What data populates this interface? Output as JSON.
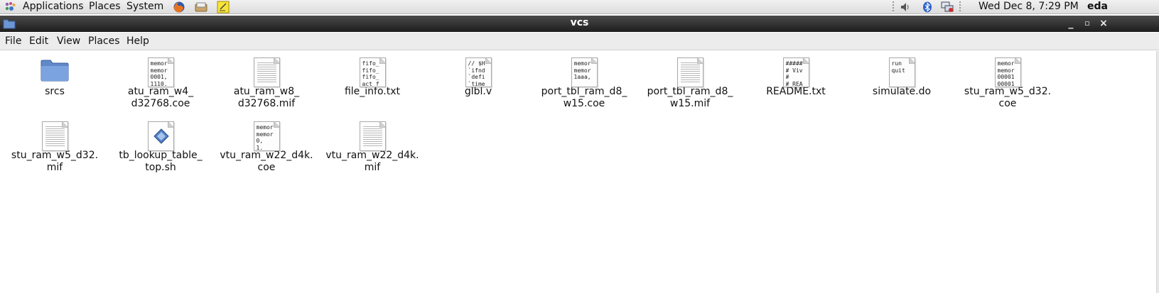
{
  "top_panel": {
    "menus": [
      "Applications",
      "Places",
      "System"
    ],
    "launchers": [
      "firefox-icon",
      "file-manager-icon",
      "notes-icon"
    ],
    "tray": [
      "volume-icon",
      "bluetooth-icon",
      "network-icon"
    ],
    "datetime": "Wed Dec  8,  7:29 PM",
    "user": "eda"
  },
  "window": {
    "title": "vcs",
    "controls": [
      "minimize",
      "maximize",
      "close"
    ]
  },
  "menubar": [
    "File",
    "Edit",
    "View",
    "Places",
    "Help"
  ],
  "files": [
    {
      "name": "srcs",
      "type": "folder"
    },
    {
      "name": "atu_ram_w4_\nd32768.coe",
      "type": "text",
      "preview": "memor\nmemor\n0001,\n1110."
    },
    {
      "name": "atu_ram_w8_\nd32768.mif",
      "type": "blank"
    },
    {
      "name": "file_info.txt",
      "type": "text",
      "preview": "fifo_\nfifo_\nfifo_\nact_f"
    },
    {
      "name": "glbl.v",
      "type": "text",
      "preview": "// $H\n`ifnd\n`defi\n`time"
    },
    {
      "name": "port_tbl_ram_d8_\nw15.coe",
      "type": "text",
      "preview": "memor\nmemor\n1aaa,"
    },
    {
      "name": "port_tbl_ram_d8_\nw15.mif",
      "type": "blank"
    },
    {
      "name": "README.txt",
      "type": "text",
      "preview": "#####\n# Viv\n#\n# REA"
    },
    {
      "name": "simulate.do",
      "type": "text",
      "preview": "run\nquit"
    },
    {
      "name": "stu_ram_w5_d32.\ncoe",
      "type": "text",
      "preview": "memor\nmemor\n00001\n00001"
    },
    {
      "name": "stu_ram_w5_d32.\nmif",
      "type": "blank"
    },
    {
      "name": "tb_lookup_table_\ntop.sh",
      "type": "script"
    },
    {
      "name": "vtu_ram_w22_d4k.\ncoe",
      "type": "text",
      "preview": "memor\nmemor\n0,\n1."
    },
    {
      "name": "vtu_ram_w22_d4k.\nmif",
      "type": "blank"
    }
  ],
  "colors": {
    "folder": "#6d96d4",
    "titlebar": "#2b2b2b"
  }
}
